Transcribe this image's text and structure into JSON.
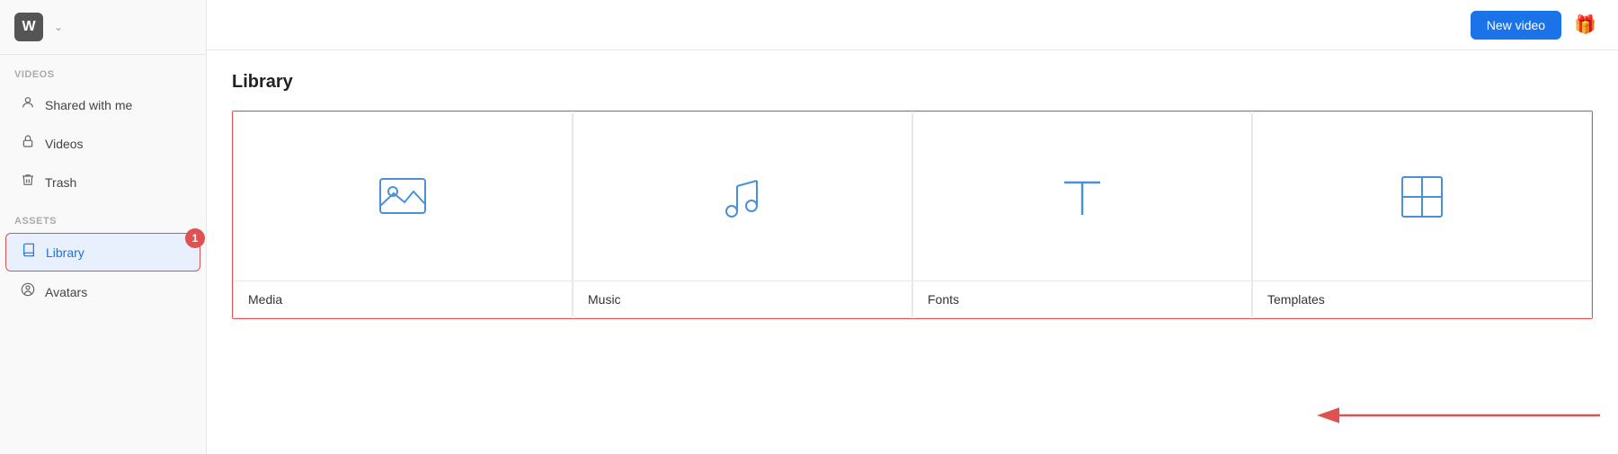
{
  "sidebar": {
    "logo_letter": "W",
    "sections": [
      {
        "label": "Videos",
        "items": [
          {
            "id": "shared-with-me",
            "label": "Shared with me",
            "icon": "person"
          },
          {
            "id": "videos",
            "label": "Videos",
            "icon": "lock"
          },
          {
            "id": "trash",
            "label": "Trash",
            "icon": "trash"
          }
        ]
      },
      {
        "label": "Assets",
        "items": [
          {
            "id": "library",
            "label": "Library",
            "icon": "book",
            "active": true,
            "badge": "1"
          },
          {
            "id": "avatars",
            "label": "Avatars",
            "icon": "avatar"
          }
        ]
      }
    ]
  },
  "topbar": {
    "new_video_button": "New video"
  },
  "page": {
    "title": "Library",
    "cards": [
      {
        "id": "media",
        "label": "Media",
        "icon": "image"
      },
      {
        "id": "music",
        "label": "Music",
        "icon": "music"
      },
      {
        "id": "fonts",
        "label": "Fonts",
        "icon": "text"
      },
      {
        "id": "templates",
        "label": "Templates",
        "icon": "layout"
      }
    ]
  }
}
